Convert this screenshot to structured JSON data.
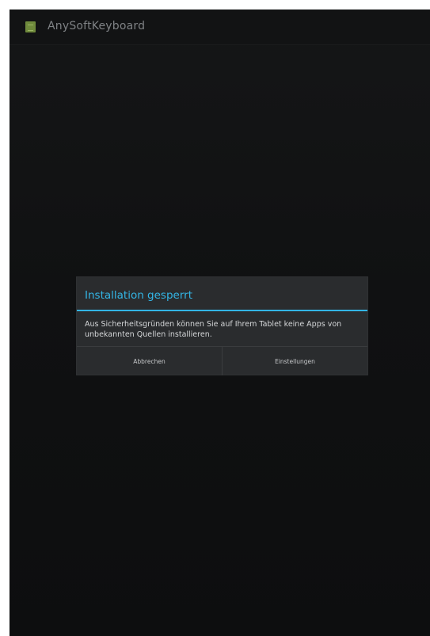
{
  "action_bar": {
    "app_icon": "keyboard-app-icon",
    "title": "AnySoftKeyboard"
  },
  "dialog": {
    "title": "Installation gesperrt",
    "message": "Aus Sicherheitsgründen können Sie auf Ihrem Tablet keine Apps von unbekannten Quellen installieren.",
    "buttons": {
      "cancel_label": "Abbrechen",
      "settings_label": "Einstellungen"
    }
  },
  "colors": {
    "accent": "#33b5e5",
    "background": "#101112",
    "dialog": "#2a2c2e"
  }
}
